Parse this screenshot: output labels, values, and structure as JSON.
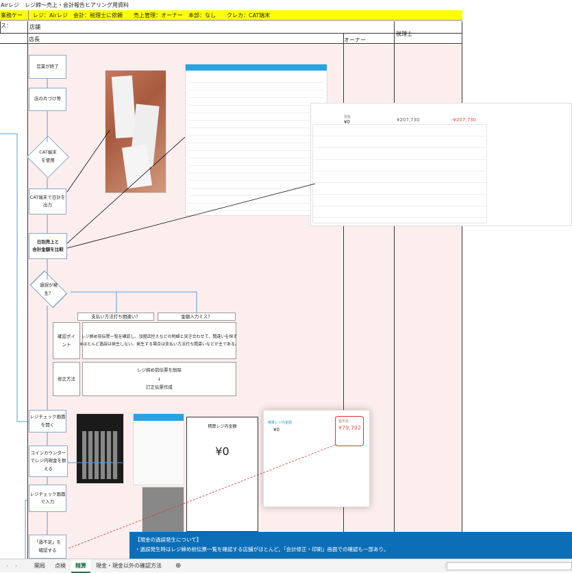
{
  "window": {
    "title": "Airレジ　レジ締〜売上・会計報告ヒアリング用資料"
  },
  "case_bar": {
    "label": "業務ケース：",
    "text": "レジ：Airレジ　会計：税理士に依頼　　売上管理：オーナー　本部：なし　　クレカ：CAT端末"
  },
  "lanes": {
    "store": "店舗",
    "manager": "店長",
    "owner": "オーナー",
    "accountant": "税理士"
  },
  "flow": {
    "step1": "営業が終了",
    "step2": "店の片づけ等",
    "decision1": "CAT端末\nを使用",
    "step3": "CAT端末で日計を\n出力",
    "step4": "日別売上と\n合計金額を比較",
    "decision2": "過誤が発\n生？",
    "step5": "レジチェック画面\nを開く",
    "step6": "コインカウンター\nでレジ内現金を数\nえる",
    "step7": "レジチェック画面\nで入力",
    "step8": "「過不足」を\n確認する"
  },
  "error_table": {
    "col1": "支払い方法打ち間違い？",
    "col2": "金額入力ミス？",
    "row1_label": "確認ポイ\nント",
    "row1_text": "レジ締め前伝票一覧を確認し、加盟店控えなどの明細と突き合わせて、間違いを探す\n※ほとんど過誤は発生しない。発生する場合は支払い方法打ち間違いなどが主である。",
    "row2_label": "修正方法",
    "row2_text": "レジ締め前伝票を削除\n↓\n訂正伝票作成"
  },
  "screens": {
    "register_app_title": "精算レジ内金額",
    "register_amount": "¥0",
    "summary_cash_label": "現金",
    "summary_cash_value": "¥0",
    "summary_total_value": "¥207,730",
    "summary_diff_value": "-¥207,730",
    "check_register_label": "精算レジ内金額",
    "check_register_value": "¥0",
    "check_diff_label": "過不足",
    "check_diff_value": "¥79,792"
  },
  "bottom_note": {
    "title": "【現金の過誤発生について】",
    "text": "・過誤発生時はレジ締め前伝票一覧を確認する店舗がほとんど。「会計修正・印刷」画面での確認も一部あり。"
  },
  "sheet_tabs": [
    "開局",
    "点検",
    "精算",
    "現金・現金以外の確認方法"
  ],
  "active_tab": "精算",
  "colors": {
    "yellow": "#ffff00",
    "lane_pink": "#fdeeee",
    "note_blue": "#0d6eb8",
    "excel_green": "#1e7145"
  }
}
